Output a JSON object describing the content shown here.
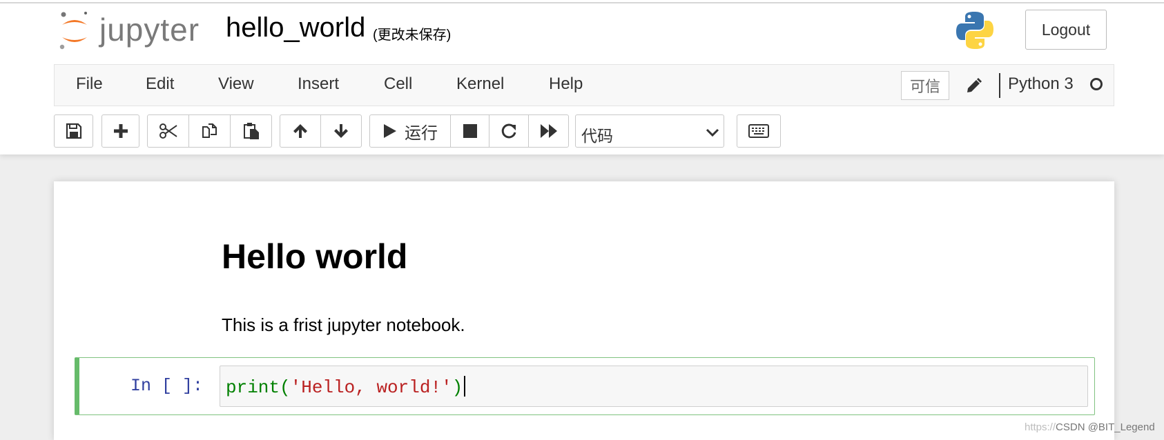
{
  "header": {
    "logo_text": "jupyter",
    "notebook_name": "hello_world",
    "save_status": "(更改未保存)",
    "logout_label": "Logout"
  },
  "menubar": {
    "items": [
      "File",
      "Edit",
      "View",
      "Insert",
      "Cell",
      "Kernel",
      "Help"
    ],
    "trusted_label": "可信",
    "kernel_name": "Python 3"
  },
  "toolbar": {
    "run_label": "运行",
    "cell_type": "代码",
    "icons": [
      "save-icon",
      "plus-icon",
      "scissors-icon",
      "copy-icon",
      "paste-icon",
      "arrow-up-icon",
      "arrow-down-icon",
      "play-icon",
      "stop-icon",
      "restart-icon",
      "fast-forward-icon",
      "keyboard-icon"
    ]
  },
  "notebook": {
    "heading": "Hello world",
    "paragraph": "This is a frist jupyter notebook.",
    "code_prompt": "In [ ]:",
    "code_builtin": "print",
    "code_open": "(",
    "code_string": "'Hello, world!'",
    "code_close": ")"
  },
  "watermark": {
    "prefix": "https://",
    "text": "CSDN @BIT_Legend"
  },
  "colors": {
    "logo_orange": "#f37726",
    "cell_selected": "#66bb6a",
    "prompt_blue": "#303f9f",
    "string_red": "#ba2121",
    "builtin_green": "#008000"
  }
}
